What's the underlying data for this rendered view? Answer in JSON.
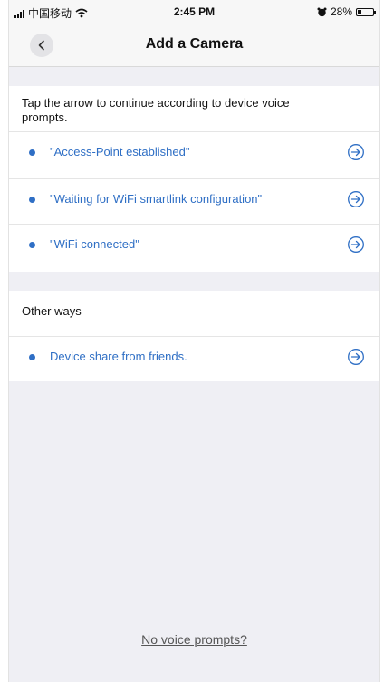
{
  "status_bar": {
    "carrier": "中国移动",
    "time": "2:45 PM",
    "battery_percent": "28%",
    "battery_level": 0.28
  },
  "nav": {
    "title": "Add a Camera",
    "back_icon": "chevron-left-icon"
  },
  "instructions": "Tap the arrow to continue according to device voice prompts.",
  "prompts": [
    {
      "label": "\"Access-Point established\""
    },
    {
      "label": "\"Waiting for WiFi smartlink configuration\""
    },
    {
      "label": "\"WiFi connected\""
    }
  ],
  "other_ways": {
    "title": "Other ways",
    "items": [
      {
        "label": "Device share from friends."
      }
    ]
  },
  "footer_link": "No voice prompts?",
  "colors": {
    "accent": "#2f6fc5",
    "background": "#efeff4",
    "bar": "#f7f7f7"
  }
}
